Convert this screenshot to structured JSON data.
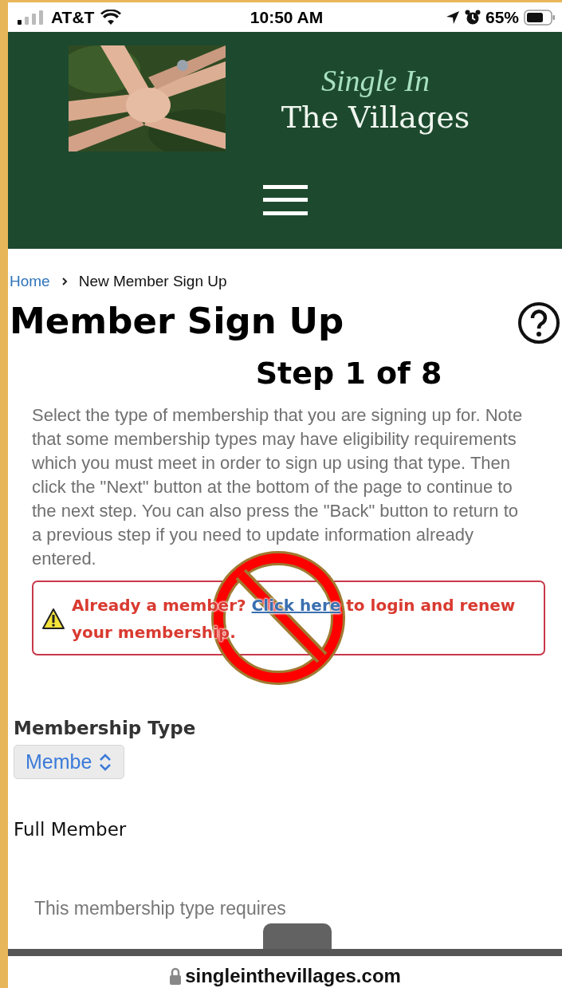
{
  "status_bar": {
    "carrier": "AT&T",
    "time": "10:50 AM",
    "battery": "65%"
  },
  "header": {
    "logo_line_1": "Single In",
    "logo_line_2": "The Villages"
  },
  "breadcrumb": [
    {
      "label": "Home",
      "kind": "link"
    },
    {
      "label": "New Member Sign Up",
      "kind": "current"
    }
  ],
  "title": "Member Sign Up",
  "step": "Step 1 of 8",
  "intro": "Select the type of membership that you are signing up for. Note that some membership types may have eligibility requirements which you must meet in order to sign up using that type. Then click the \"Next\" button at the bottom of the page to continue to the next step. You can also press the \"Back\" button to return to a previous step if you need to update information already entered.",
  "alert": {
    "before": "Already a member? ",
    "link": "Click here",
    "after": " to login and renew your membership."
  },
  "membership_type": {
    "label": "Membership Type",
    "select_value": "Membe",
    "selected_name": "Full Member",
    "note": "This membership type requires"
  },
  "address_bar": {
    "url": "singleinthevillages.com"
  }
}
